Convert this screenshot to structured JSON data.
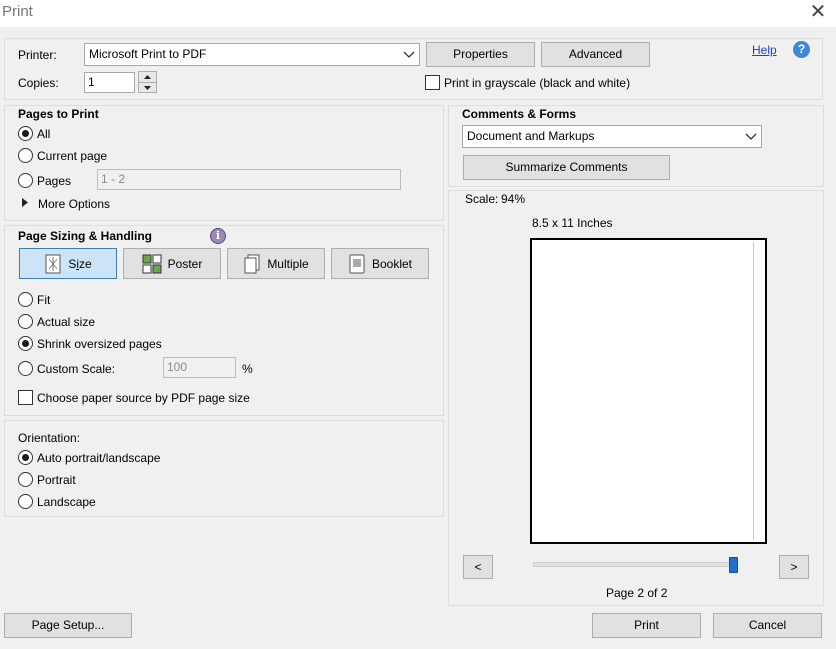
{
  "window": {
    "title": "Print"
  },
  "printer": {
    "label": "Printer:",
    "value": "Microsoft Print to PDF",
    "properties": "Properties",
    "advanced": "Advanced",
    "help": "Help"
  },
  "copies": {
    "label": "Copies:",
    "value": "1"
  },
  "grayscale": {
    "label": "Print in grayscale (black and white)",
    "checked": false
  },
  "pages_to_print": {
    "title": "Pages to Print",
    "all": "All",
    "current": "Current page",
    "pages": "Pages",
    "pages_range": "1 - 2",
    "more": "More Options",
    "selected": "All"
  },
  "sizing": {
    "title": "Page Sizing & Handling",
    "buttons": {
      "size": "Size",
      "poster": "Poster",
      "multiple": "Multiple",
      "booklet": "Booklet"
    },
    "selected_button": "Size",
    "fit": "Fit",
    "actual": "Actual size",
    "shrink": "Shrink oversized pages",
    "custom": "Custom Scale:",
    "custom_value": "100",
    "percent": "%",
    "paper_source": "Choose paper source by PDF page size",
    "selected": "Shrink oversized pages"
  },
  "orientation": {
    "title": "Orientation:",
    "auto": "Auto portrait/landscape",
    "portrait": "Portrait",
    "landscape": "Landscape",
    "selected": "Auto portrait/landscape"
  },
  "comments": {
    "title": "Comments & Forms",
    "value": "Document and Markups",
    "summarize": "Summarize Comments"
  },
  "preview": {
    "scale_label": "Scale:",
    "scale_value": "94%",
    "size": "8.5 x 11 Inches",
    "prev": "<",
    "next": ">",
    "page_indicator": "Page 2 of 2",
    "slider_fraction": 1.0
  },
  "footer": {
    "page_setup": "Page Setup...",
    "print": "Print",
    "cancel": "Cancel"
  }
}
